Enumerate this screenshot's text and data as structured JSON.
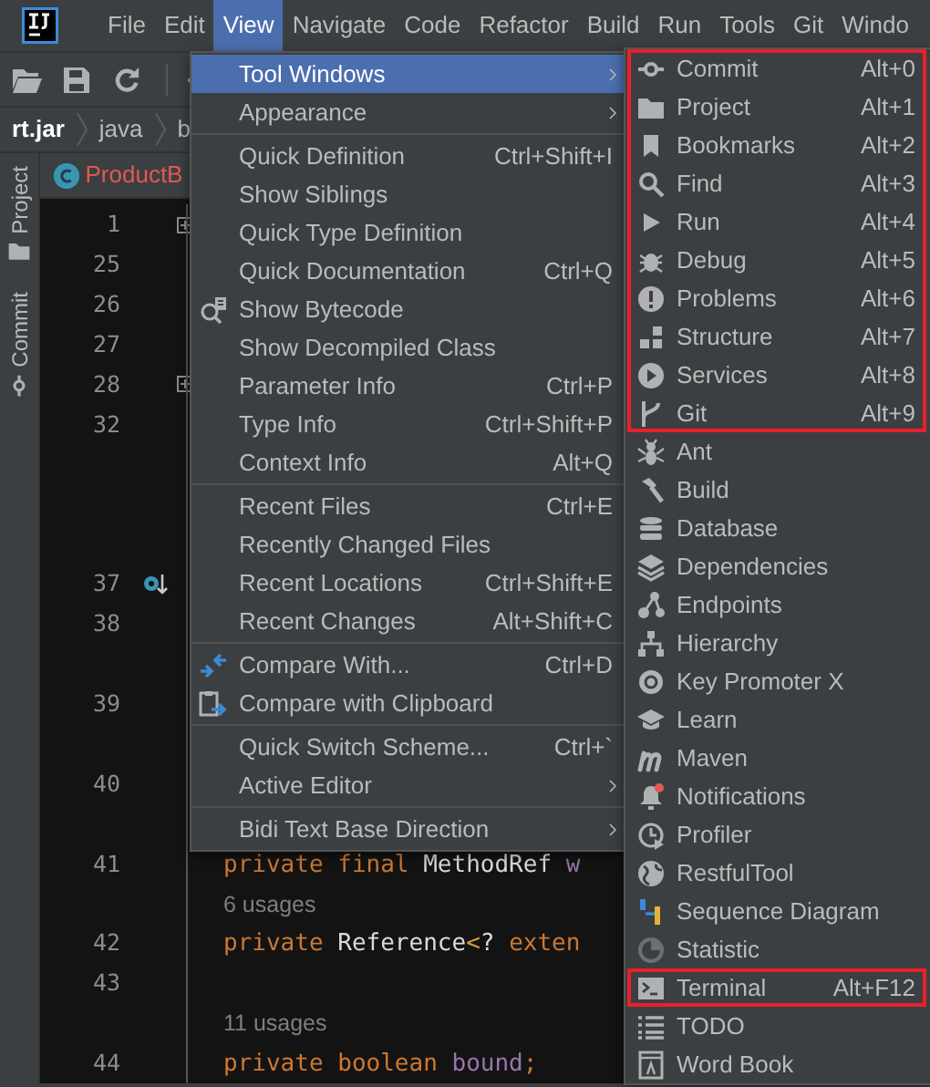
{
  "menu_bar": [
    {
      "label": "File",
      "selected": false
    },
    {
      "label": "Edit",
      "selected": false
    },
    {
      "label": "View",
      "selected": true
    },
    {
      "label": "Navigate",
      "selected": false
    },
    {
      "label": "Code",
      "selected": false
    },
    {
      "label": "Refactor",
      "selected": false
    },
    {
      "label": "Build",
      "selected": false
    },
    {
      "label": "Run",
      "selected": false
    },
    {
      "label": "Tools",
      "selected": false
    },
    {
      "label": "Git",
      "selected": false
    },
    {
      "label": "Windo",
      "selected": false
    }
  ],
  "breadcrumbs": [
    "rt.jar",
    "java",
    "b"
  ],
  "tool_strip": [
    "Project",
    "Commit"
  ],
  "editor_tab": {
    "title": "ProductB"
  },
  "editor_rows": [
    {
      "kind": "line",
      "number": "1",
      "fold": true
    },
    {
      "kind": "line",
      "number": "25"
    },
    {
      "kind": "line",
      "number": "26"
    },
    {
      "kind": "line",
      "number": "27"
    },
    {
      "kind": "line",
      "number": "28",
      "fold": true
    },
    {
      "kind": "line",
      "number": "32"
    },
    {
      "kind": "blank"
    },
    {
      "kind": "blank"
    },
    {
      "kind": "blank"
    },
    {
      "kind": "line",
      "number": "37",
      "override": true
    },
    {
      "kind": "line",
      "number": "38"
    },
    {
      "kind": "blank"
    },
    {
      "kind": "line",
      "number": "39"
    },
    {
      "kind": "blank"
    },
    {
      "kind": "line",
      "number": "40"
    },
    {
      "kind": "blank"
    },
    {
      "kind": "line",
      "number": "41",
      "code": [
        {
          "text": "private ",
          "kind": "keyword"
        },
        {
          "text": "final ",
          "kind": "keyword"
        },
        {
          "text": "MethodRef ",
          "kind": "type"
        },
        {
          "text": "w",
          "kind": "field"
        }
      ]
    },
    {
      "kind": "hint",
      "text": "6 usages"
    },
    {
      "kind": "line",
      "number": "42",
      "code": [
        {
          "text": "private ",
          "kind": "keyword"
        },
        {
          "text": "Reference",
          "kind": "type"
        },
        {
          "text": "<",
          "kind": "operator"
        },
        {
          "text": "? ",
          "kind": "type"
        },
        {
          "text": "exten",
          "kind": "keyword"
        }
      ]
    },
    {
      "kind": "line",
      "number": "43"
    },
    {
      "kind": "hint",
      "text": "11 usages"
    },
    {
      "kind": "line",
      "number": "44",
      "code": [
        {
          "text": "private ",
          "kind": "keyword"
        },
        {
          "text": "boolean ",
          "kind": "keyword"
        },
        {
          "text": "bound",
          "kind": "field"
        },
        {
          "text": ";",
          "kind": "keyword"
        }
      ]
    }
  ],
  "view_menu": [
    {
      "kind": "item",
      "label": "Tool Windows",
      "submenu": true,
      "selected": true
    },
    {
      "kind": "item",
      "label": "Appearance",
      "submenu": true,
      "selected": false
    },
    {
      "kind": "separator"
    },
    {
      "kind": "item",
      "label": "Quick Definition",
      "shortcut": "Ctrl+Shift+I",
      "selected": false
    },
    {
      "kind": "item",
      "label": "Show Siblings",
      "selected": false
    },
    {
      "kind": "item",
      "label": "Quick Type Definition",
      "selected": false
    },
    {
      "kind": "item",
      "label": "Quick Documentation",
      "shortcut": "Ctrl+Q",
      "selected": false
    },
    {
      "kind": "item",
      "label": "Show Bytecode",
      "icon": true,
      "selected": false
    },
    {
      "kind": "item",
      "label": "Show Decompiled Class",
      "selected": false
    },
    {
      "kind": "item",
      "label": "Parameter Info",
      "shortcut": "Ctrl+P",
      "selected": false
    },
    {
      "kind": "item",
      "label": "Type Info",
      "shortcut": "Ctrl+Shift+P",
      "selected": false
    },
    {
      "kind": "item",
      "label": "Context Info",
      "shortcut": "Alt+Q",
      "selected": false
    },
    {
      "kind": "separator"
    },
    {
      "kind": "item",
      "label": "Recent Files",
      "shortcut": "Ctrl+E",
      "selected": false
    },
    {
      "kind": "item",
      "label": "Recently Changed Files",
      "selected": false
    },
    {
      "kind": "item",
      "label": "Recent Locations",
      "shortcut": "Ctrl+Shift+E",
      "selected": false
    },
    {
      "kind": "item",
      "label": "Recent Changes",
      "shortcut": "Alt+Shift+C",
      "selected": false
    },
    {
      "kind": "separator"
    },
    {
      "kind": "item",
      "label": "Compare With...",
      "shortcut": "Ctrl+D",
      "icon": true,
      "selected": false
    },
    {
      "kind": "item",
      "label": "Compare with Clipboard",
      "icon": true,
      "selected": false
    },
    {
      "kind": "separator"
    },
    {
      "kind": "item",
      "label": "Quick Switch Scheme...",
      "shortcut": "Ctrl+`",
      "selected": false
    },
    {
      "kind": "item",
      "label": "Active Editor",
      "submenu": true,
      "selected": false
    },
    {
      "kind": "separator"
    },
    {
      "kind": "item",
      "label": "Bidi Text Base Direction",
      "submenu": true,
      "selected": false
    }
  ],
  "tool_windows_menu": [
    {
      "highlighted": true,
      "items": [
        {
          "label": "Commit",
          "shortcut": "Alt+0"
        },
        {
          "label": "Project",
          "shortcut": "Alt+1"
        },
        {
          "label": "Bookmarks",
          "shortcut": "Alt+2"
        },
        {
          "label": "Find",
          "shortcut": "Alt+3"
        },
        {
          "label": "Run",
          "shortcut": "Alt+4"
        },
        {
          "label": "Debug",
          "shortcut": "Alt+5"
        },
        {
          "label": "Problems",
          "shortcut": "Alt+6"
        },
        {
          "label": "Structure",
          "shortcut": "Alt+7"
        },
        {
          "label": "Services",
          "shortcut": "Alt+8"
        },
        {
          "label": "Git",
          "shortcut": "Alt+9"
        }
      ]
    },
    {
      "highlighted": false,
      "items": [
        {
          "label": "Ant"
        },
        {
          "label": "Build"
        },
        {
          "label": "Database"
        },
        {
          "label": "Dependencies"
        },
        {
          "label": "Endpoints"
        },
        {
          "label": "Hierarchy"
        },
        {
          "label": "Key Promoter X"
        },
        {
          "label": "Learn"
        },
        {
          "label": "Maven"
        },
        {
          "label": "Notifications"
        },
        {
          "label": "Profiler"
        },
        {
          "label": "RestfulTool"
        },
        {
          "label": "Sequence Diagram"
        },
        {
          "label": "Statistic"
        }
      ]
    },
    {
      "highlighted": true,
      "items": [
        {
          "label": "Terminal",
          "shortcut": "Alt+F12"
        }
      ]
    },
    {
      "highlighted": false,
      "items": [
        {
          "label": "TODO"
        },
        {
          "label": "Word Book"
        }
      ]
    }
  ]
}
